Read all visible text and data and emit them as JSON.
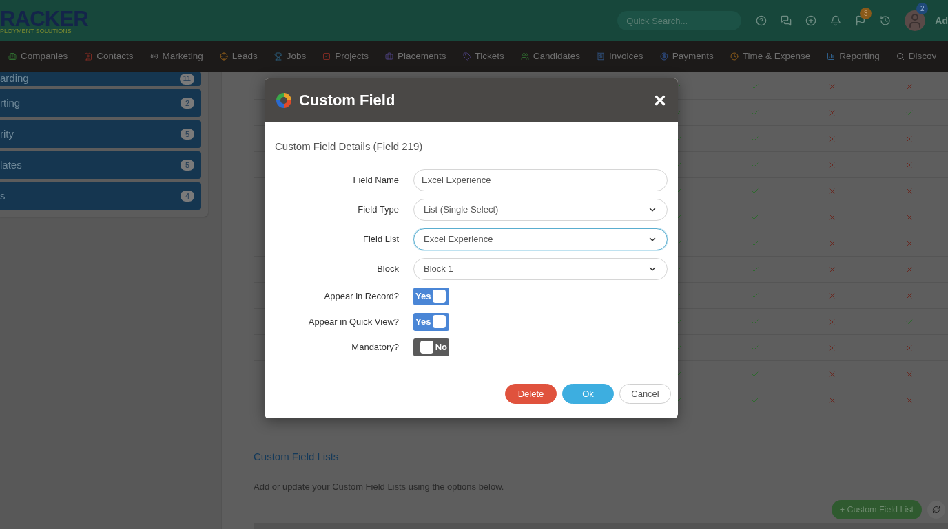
{
  "header": {
    "logo": {
      "title": "RACKER",
      "subtitle": "PLOYMENT SOLUTIONS"
    },
    "search": {
      "placeholder": "Quick Search..."
    },
    "flag_badge": "3",
    "avatar_badge": "2",
    "user_name": "Ad"
  },
  "nav": [
    "Companies",
    "Contacts",
    "Marketing",
    "Leads",
    "Jobs",
    "Projects",
    "Placements",
    "Tickets",
    "Candidates",
    "Invoices",
    "Payments",
    "Time & Expense",
    "Reporting",
    "Discov"
  ],
  "sidebar": {
    "items": [
      {
        "label": "arding",
        "count": "11"
      },
      {
        "label": "rting",
        "count": "2"
      },
      {
        "label": "rity",
        "count": "5"
      },
      {
        "label": "lates",
        "count": "5"
      },
      {
        "label": "s",
        "count": "4"
      }
    ]
  },
  "table": {
    "rows": [
      {
        "cells": [
          {
            "checked": true
          },
          {
            "checked": true
          },
          {
            "checked": false
          },
          {
            "checked": false
          }
        ]
      },
      {
        "cells": [
          {
            "checked": true
          },
          {
            "checked": true
          },
          {
            "checked": false
          },
          {
            "checked": true
          }
        ]
      },
      {
        "cells": [
          {
            "checked": true
          },
          {
            "checked": true
          },
          {
            "checked": false
          },
          {
            "checked": false
          }
        ]
      },
      {
        "cells": [
          {
            "checked": true
          },
          {
            "checked": true
          },
          {
            "checked": false
          },
          {
            "checked": false
          }
        ]
      },
      {
        "cells": [
          {
            "checked": true
          },
          {
            "checked": true
          },
          {
            "checked": false
          },
          {
            "checked": false
          }
        ]
      },
      {
        "cells": [
          {
            "checked": true
          },
          {
            "checked": true
          },
          {
            "checked": false
          },
          {
            "checked": false
          }
        ]
      },
      {
        "cells": [
          {
            "checked": true
          },
          {
            "checked": true
          },
          {
            "checked": false
          },
          {
            "checked": false
          }
        ]
      },
      {
        "cells": [
          {
            "checked": true
          },
          {
            "checked": true
          },
          {
            "checked": false
          },
          {
            "checked": false
          }
        ]
      },
      {
        "cells": [
          {
            "checked": true
          },
          {
            "checked": true
          },
          {
            "checked": false
          },
          {
            "checked": false
          }
        ]
      },
      {
        "cells": [
          {
            "checked": true
          },
          {
            "checked": true
          },
          {
            "checked": false
          },
          {
            "checked": true
          }
        ]
      },
      {
        "cells": [
          {
            "checked": true
          },
          {
            "checked": true
          },
          {
            "checked": false
          },
          {
            "checked": false
          }
        ]
      },
      {
        "cells": [
          {
            "checked": true
          },
          {
            "checked": true
          },
          {
            "checked": false
          },
          {
            "checked": false
          }
        ]
      },
      {
        "cells": [
          {
            "checked": true
          },
          {
            "checked": true
          },
          {
            "checked": false
          },
          {
            "checked": false
          }
        ]
      }
    ]
  },
  "lists_section": {
    "title": "Custom Field Lists",
    "description": "Add or update your Custom Field Lists using the options below.",
    "add_button": "+ Custom Field List"
  },
  "dialog": {
    "title": "Custom Field",
    "subtitle": "Custom Field Details (Field 219)",
    "fields": [
      {
        "kind": "text",
        "label": "Field Name",
        "value": "Excel Experience"
      },
      {
        "kind": "select",
        "label": "Field Type",
        "value": "List (Single Select)"
      },
      {
        "kind": "select",
        "label": "Field List",
        "value": "Excel Experience",
        "focused": true
      },
      {
        "kind": "select",
        "label": "Block",
        "value": "Block 1"
      },
      {
        "kind": "toggle",
        "label": "Appear in Record?",
        "on": true,
        "text": "Yes"
      },
      {
        "kind": "toggle",
        "label": "Appear in Quick View?",
        "on": true,
        "text": "Yes"
      },
      {
        "kind": "toggle",
        "label": "Mandatory?",
        "on": false,
        "text": "No"
      }
    ],
    "buttons": [
      {
        "kind": "danger",
        "label": "Delete"
      },
      {
        "kind": "primary",
        "label": "Ok"
      },
      {
        "kind": "default",
        "label": "Cancel"
      }
    ]
  }
}
